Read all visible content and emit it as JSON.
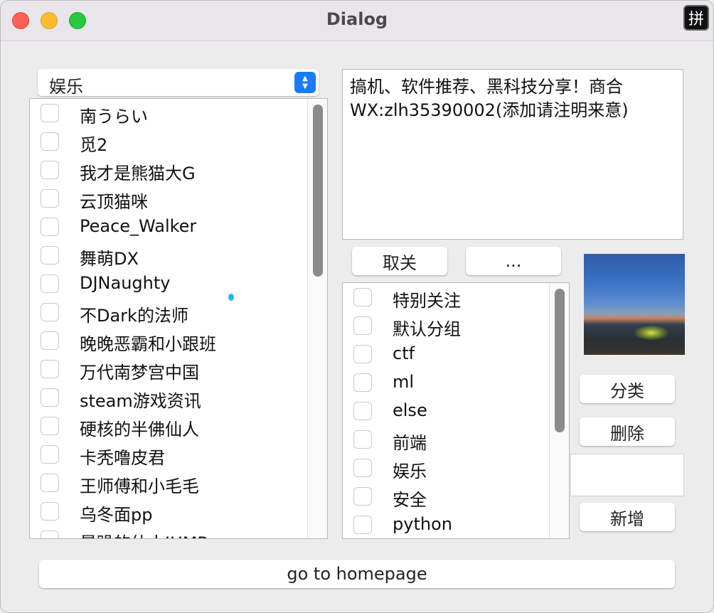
{
  "window": {
    "title": "Dialog",
    "ime_indicator": "拼"
  },
  "category_select": {
    "selected": "娱乐"
  },
  "user_list": {
    "items": [
      {
        "label": "南うらい"
      },
      {
        "label": "觅2"
      },
      {
        "label": "我才是熊猫大G"
      },
      {
        "label": "云顶猫咪"
      },
      {
        "label": "Peace_Walker"
      },
      {
        "label": "舞萌DX"
      },
      {
        "label": "DJNaughty"
      },
      {
        "label": "不Dark的法师"
      },
      {
        "label": "晚晚恶霸和小跟班"
      },
      {
        "label": "万代南梦宫中国"
      },
      {
        "label": "steam游戏资讯"
      },
      {
        "label": "硬核的半佛仙人"
      },
      {
        "label": "卡秃噜皮君"
      },
      {
        "label": "王师傅和小毛毛"
      },
      {
        "label": "乌冬面pp"
      },
      {
        "label": "暴躁的仙人JUMP"
      }
    ]
  },
  "description": {
    "text": "搞机、软件推荐、黑科技分享！商合 WX:zlh35390002(添加请注明来意)"
  },
  "actions": {
    "unfollow_label": "取关",
    "more_label": "..."
  },
  "group_list": {
    "items": [
      {
        "label": "特别关注"
      },
      {
        "label": "默认分组"
      },
      {
        "label": "ctf"
      },
      {
        "label": "ml"
      },
      {
        "label": "else"
      },
      {
        "label": "前端"
      },
      {
        "label": "娱乐"
      },
      {
        "label": "安全"
      },
      {
        "label": "python"
      }
    ]
  },
  "side_buttons": {
    "classify_label": "分类",
    "delete_label": "删除",
    "add_label": "新增"
  },
  "new_group_input": {
    "value": ""
  },
  "homepage_button": {
    "label": "go to homepage"
  },
  "colors": {
    "accent": "#1a7cf5",
    "close": "#fe5f57",
    "minimize": "#febc2e",
    "maximize": "#28c840"
  },
  "icons": [
    "close-icon",
    "minimize-icon",
    "maximize-icon",
    "chevron-updown-icon",
    "avatar-image"
  ]
}
